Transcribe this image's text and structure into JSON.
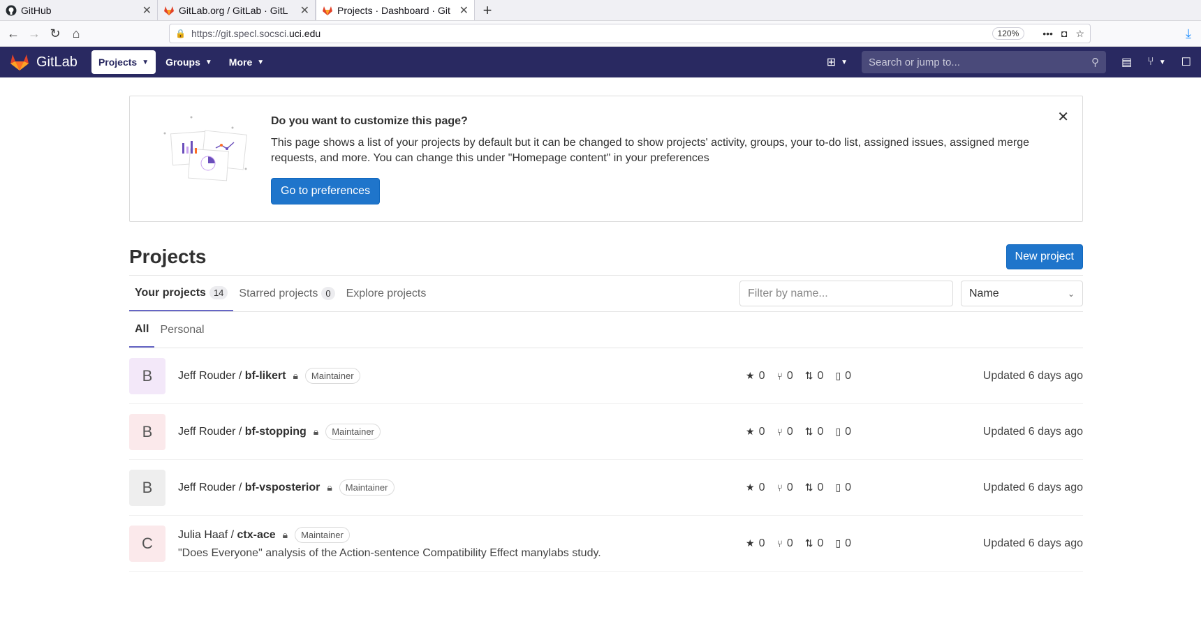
{
  "browser": {
    "tabs": [
      {
        "title": "GitHub",
        "icon": "github-icon"
      },
      {
        "title": "GitLab.org / GitLab · GitL",
        "icon": "gitlab-icon"
      },
      {
        "title": "Projects · Dashboard · Git",
        "icon": "gitlab-icon",
        "active": true
      }
    ],
    "url_prefix": "https://git.specl.socsci.",
    "url_domain": "uci.edu",
    "zoom": "120%"
  },
  "header": {
    "brand": "GitLab",
    "nav": [
      {
        "label": "Projects",
        "active": true
      },
      {
        "label": "Groups"
      },
      {
        "label": "More"
      }
    ],
    "search_placeholder": "Search or jump to..."
  },
  "banner": {
    "title": "Do you want to customize this page?",
    "body": "This page shows a list of your projects by default but it can be changed to show projects' activity, groups, your to-do list, assigned issues, assigned merge requests, and more. You can change this under \"Homepage content\" in your preferences",
    "button": "Go to preferences"
  },
  "projects_page": {
    "title": "Projects",
    "new_button": "New project",
    "tabs": [
      {
        "label": "Your projects",
        "count": "14",
        "active": true
      },
      {
        "label": "Starred projects",
        "count": "0"
      },
      {
        "label": "Explore projects"
      }
    ],
    "filter_placeholder": "Filter by name...",
    "sort_label": "Name",
    "subtabs": [
      {
        "label": "All",
        "active": true
      },
      {
        "label": "Personal"
      }
    ]
  },
  "projects": [
    {
      "letter": "B",
      "namespace": "Jeff Rouder / ",
      "name": "bf-likert",
      "role": "Maintainer",
      "description": "",
      "stars": "0",
      "forks": "0",
      "mrs": "0",
      "issues": "0",
      "updated": "Updated 6 days ago",
      "avatar_color": "#f3e8f9"
    },
    {
      "letter": "B",
      "namespace": "Jeff Rouder / ",
      "name": "bf-stopping",
      "role": "Maintainer",
      "description": "",
      "stars": "0",
      "forks": "0",
      "mrs": "0",
      "issues": "0",
      "updated": "Updated 6 days ago",
      "avatar_color": "#fbe9eb"
    },
    {
      "letter": "B",
      "namespace": "Jeff Rouder / ",
      "name": "bf-vsposterior",
      "role": "Maintainer",
      "description": "",
      "stars": "0",
      "forks": "0",
      "mrs": "0",
      "issues": "0",
      "updated": "Updated 6 days ago",
      "avatar_color": "#eeeeee"
    },
    {
      "letter": "C",
      "namespace": "Julia Haaf / ",
      "name": "ctx-ace",
      "role": "Maintainer",
      "description": "\"Does Everyone\" analysis of the Action-sentence Compatibility Effect manylabs study.",
      "stars": "0",
      "forks": "0",
      "mrs": "0",
      "issues": "0",
      "updated": "Updated 6 days ago",
      "avatar_color": "#fbe9eb"
    }
  ]
}
